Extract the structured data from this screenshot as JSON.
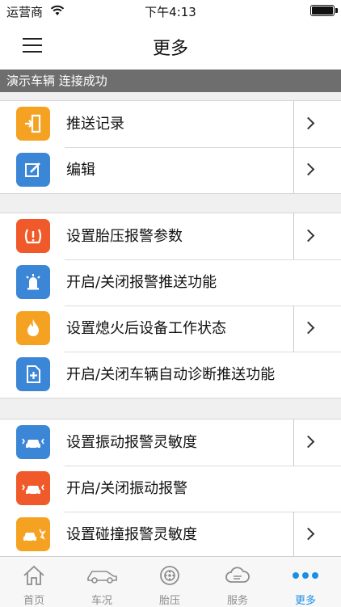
{
  "status_bar": {
    "carrier": "运营商",
    "time": "下午4:13"
  },
  "nav": {
    "title": "更多"
  },
  "banner": {
    "text": "演示车辆 连接成功"
  },
  "colors": {
    "accent": "#1a8fe6",
    "orange": "#f5a223",
    "blue": "#3b86d6",
    "red": "#f05a2a",
    "banner_bg": "#6e6e6e"
  },
  "groups": [
    {
      "items": [
        {
          "label": "推送记录",
          "icon": "exit-door-icon",
          "color": "#f5a223",
          "has_arrow": true
        },
        {
          "label": "编辑",
          "icon": "edit-pencil-icon",
          "color": "#3b86d6",
          "has_arrow": true
        }
      ]
    },
    {
      "items": [
        {
          "label": "设置胎压报警参数",
          "icon": "tire-pressure-warning-icon",
          "color": "#f05a2a",
          "has_arrow": true
        },
        {
          "label": "开启/关闭报警推送功能",
          "icon": "alarm-push-icon",
          "color": "#3b86d6",
          "has_arrow": false
        },
        {
          "label": "设置熄火后设备工作状态",
          "icon": "flame-icon",
          "color": "#f5a223",
          "has_arrow": true
        },
        {
          "label": "开启/关闭车辆自动诊断推送功能",
          "icon": "document-plus-icon",
          "color": "#3b86d6",
          "has_arrow": false
        }
      ]
    },
    {
      "items": [
        {
          "label": "设置振动报警灵敏度",
          "icon": "car-vibration-icon",
          "color": "#3b86d6",
          "has_arrow": true
        },
        {
          "label": "开启/关闭振动报警",
          "icon": "car-vibration-alert-icon",
          "color": "#f05a2a",
          "has_arrow": false
        },
        {
          "label": "设置碰撞报警灵敏度",
          "icon": "car-collision-icon",
          "color": "#f5a223",
          "has_arrow": true
        }
      ]
    }
  ],
  "tabs": [
    {
      "label": "首页",
      "icon": "home-icon",
      "active": false
    },
    {
      "label": "车况",
      "icon": "car-outline-icon",
      "active": false
    },
    {
      "label": "胎压",
      "icon": "tire-icon",
      "active": false
    },
    {
      "label": "服务",
      "icon": "cloud-service-icon",
      "active": false
    },
    {
      "label": "更多",
      "icon": "more-dots-icon",
      "active": true
    }
  ]
}
